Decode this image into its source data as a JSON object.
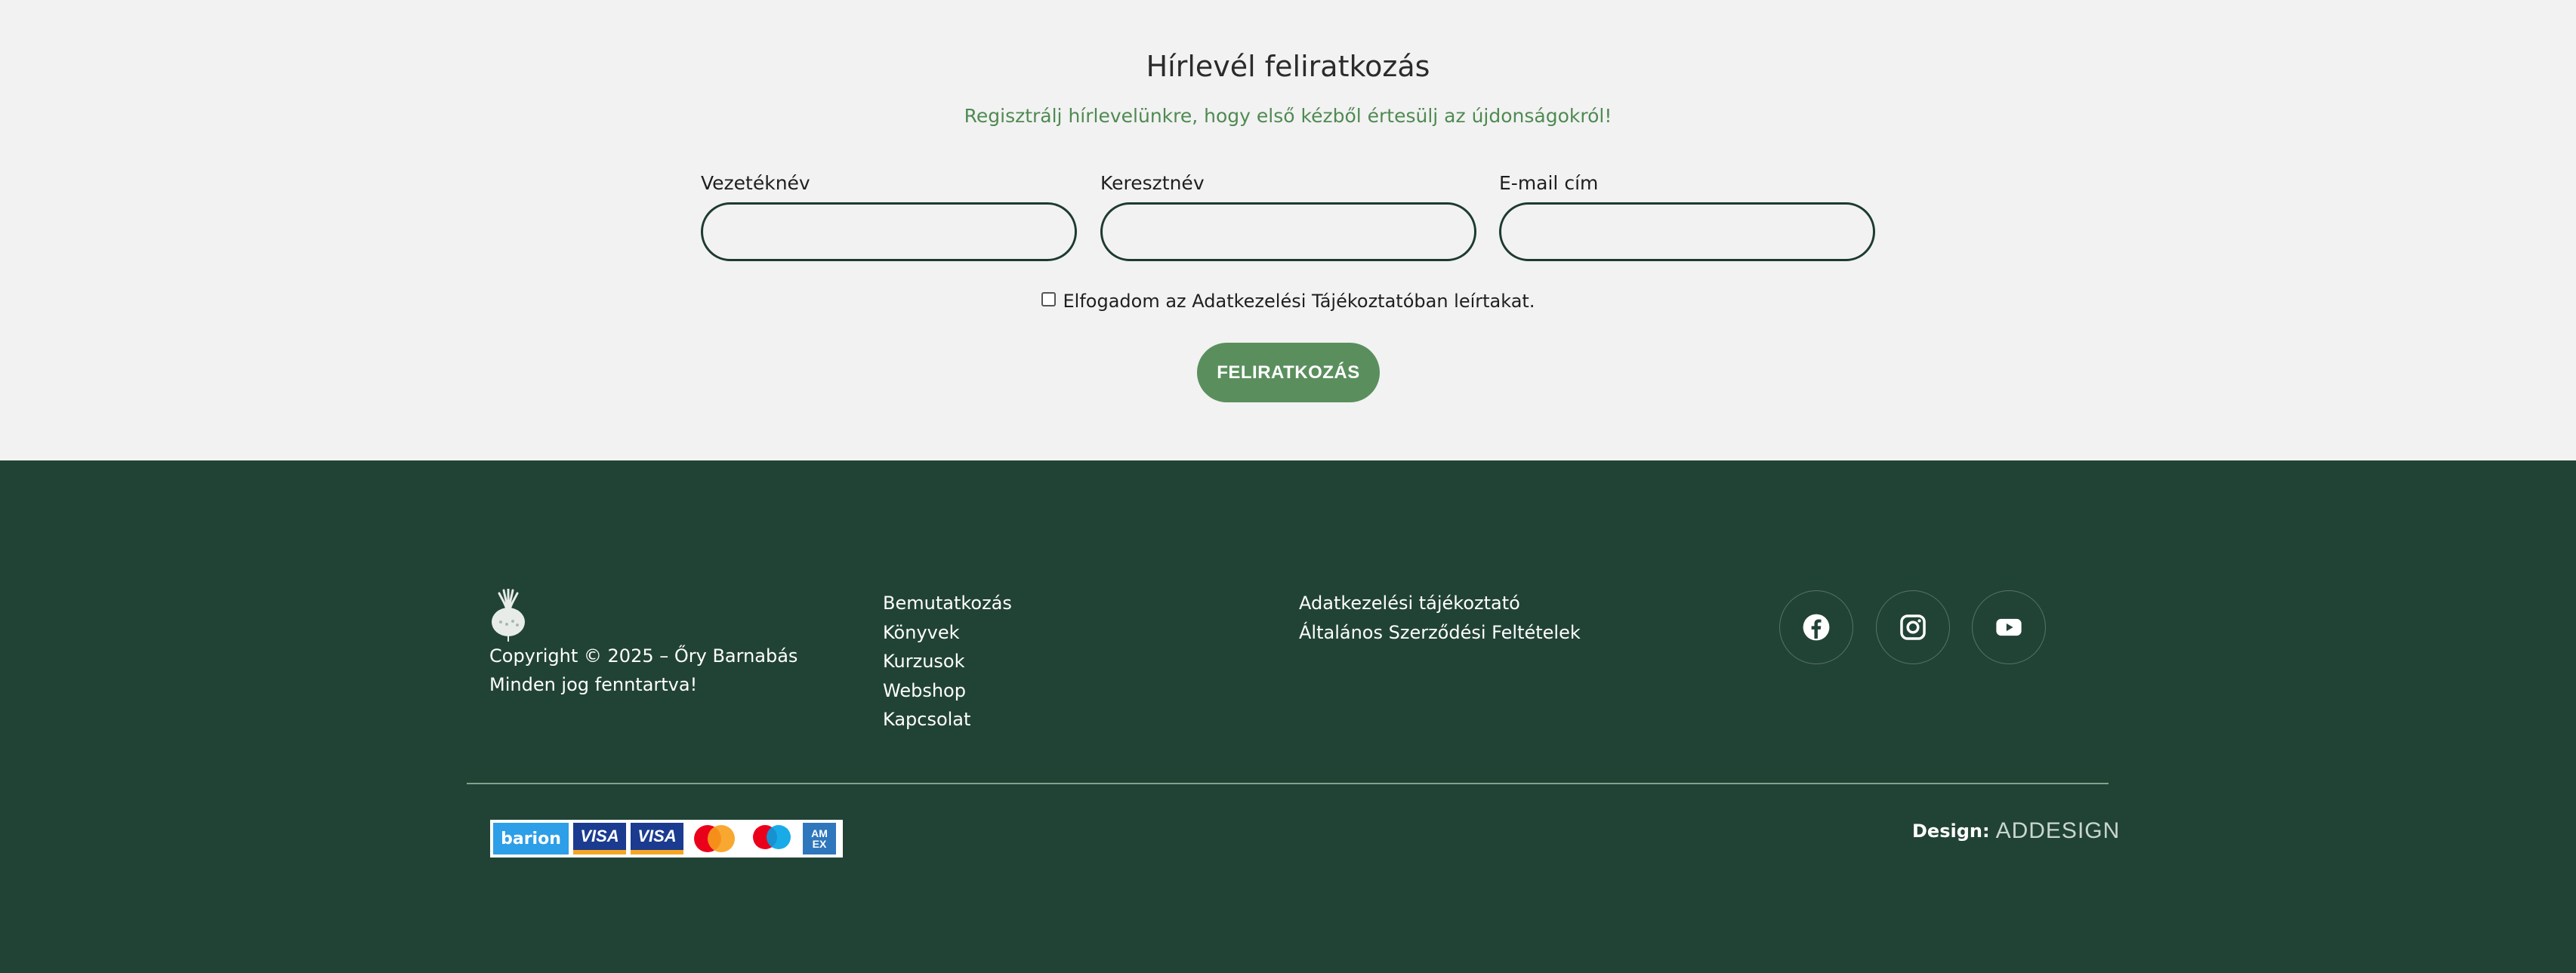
{
  "newsletter": {
    "title": "Hírlevél feliratkozás",
    "subtitle": "Regisztrálj hírlevelünkre, hogy első kézből értesülj az újdonságokról!",
    "fields": {
      "last_name_label": "Vezetéknév",
      "first_name_label": "Keresztnév",
      "email_label": "E-mail cím"
    },
    "consent_text": "Elfogadom az Adatkezelési Tájékoztatóban leírtakat.",
    "submit_label": "FELIRATKOZÁS"
  },
  "footer": {
    "copyright_line1": "Copyright © 2025 – Őry Barnabás",
    "copyright_line2": "Minden jog fenntartva!",
    "nav_links": [
      "Bemutatkozás",
      "Könyvek",
      "Kurzusok",
      "Webshop",
      "Kapcsolat"
    ],
    "legal_links": [
      "Adatkezelési tájékoztató",
      "Általános Szerződési Feltételek"
    ],
    "social": [
      "facebook-icon",
      "instagram-icon",
      "youtube-icon"
    ],
    "payments": {
      "barion": "barion",
      "visa": "VISA",
      "visa_electron": "VISA",
      "amex": "AM EX"
    },
    "design_label": "Design:",
    "design_brand": "ADDESIGN"
  },
  "colors": {
    "footer_bg": "#214335",
    "accent_green": "#5a8f5d",
    "subtitle_green": "#4f8a52",
    "page_bg": "#f2f2f2"
  }
}
